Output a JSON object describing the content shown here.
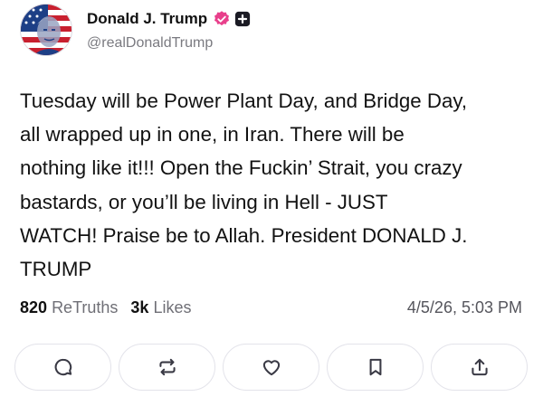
{
  "post": {
    "author": {
      "display_name": "Donald J. Trump",
      "handle": "@realDonaldTrump",
      "verified": true
    },
    "text": "Tuesday will be Power Plant Day, and Bridge Day,\nall wrapped up in one, in Iran. There will be\nnothing like it!!! Open the Fuckin’ Strait, you crazy\nbastards, or you’ll be living in Hell - JUST\nWATCH! Praise be to Allah. President DONALD J.\nTRUMP",
    "stats": {
      "retruths_count": "820",
      "retruths_label": "ReTruths",
      "likes_count": "3k",
      "likes_label": "Likes"
    },
    "timestamp": "4/5/26, 5:03 PM"
  },
  "actions": [
    {
      "name": "reply",
      "icon": "reply-icon"
    },
    {
      "name": "retruth",
      "icon": "retruth-icon"
    },
    {
      "name": "like",
      "icon": "heart-icon"
    },
    {
      "name": "bookmark",
      "icon": "bookmark-icon"
    },
    {
      "name": "share",
      "icon": "share-icon"
    }
  ],
  "colors": {
    "verified_badge": "#e83f8b",
    "muted_text": "#6f6f76",
    "button_border": "#e3e3ea",
    "icon": "#3a3a45"
  }
}
